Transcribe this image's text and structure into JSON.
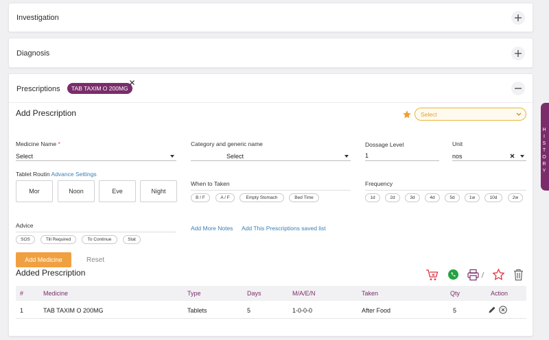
{
  "investigation": {
    "title": "Investigation"
  },
  "diagnosis": {
    "title": "Diagnosis"
  },
  "prescriptions": {
    "title": "Prescriptions",
    "tag": "TAB TAXIM O 200MG",
    "add_title": "Add Prescription",
    "saved_select_placeholder": "Select",
    "medicine": {
      "label": "Medicine Name",
      "required": "*",
      "value": "Select"
    },
    "category": {
      "label": "Category and generic name",
      "value": "Select"
    },
    "dosage": {
      "label": "Dossage Level",
      "value": "1"
    },
    "unit": {
      "label": "Unit",
      "value": "nos"
    },
    "routine": {
      "label": "Tablet Routin",
      "link": "Advance Settings",
      "buttons": [
        "Mor",
        "Noon",
        "Eve",
        "Night"
      ]
    },
    "when": {
      "label": "When to Taken",
      "chips": [
        "B / F",
        "A / F",
        "Empty Stomach",
        "Bed Time"
      ]
    },
    "frequency": {
      "label": "Frequency",
      "chips": [
        "1d",
        "2d",
        "3d",
        "4d",
        "5d",
        "1w",
        "10d",
        "2w"
      ]
    },
    "advice": {
      "label": "Advice",
      "chips": [
        "SOS",
        "Till Required",
        "To Continue",
        "Stat"
      ]
    },
    "add_more_notes": "Add More Notes",
    "add_saved_list": "Add This Prescriptions saved list",
    "add_medicine_btn": "Add Medicine",
    "reset_btn": "Reset",
    "added_title": "Added Prescription",
    "table": {
      "headers": [
        "#",
        "Medicine",
        "Type",
        "Days",
        "M/A/E/N",
        "Taken",
        "Qty",
        "Action"
      ],
      "rows": [
        [
          "1",
          "TAB TAXIM O 200MG",
          "Tablets",
          "5",
          "1-0-0-0",
          "After Food",
          "5"
        ]
      ]
    }
  },
  "history_tab": [
    "H",
    "I",
    "S",
    "T",
    "O",
    "R",
    "Y"
  ],
  "colors": {
    "accent": "#7a2d6a",
    "orange": "#f0a040",
    "link": "#3a7fb3",
    "red": "#e03040",
    "whatsapp": "#25a244"
  }
}
